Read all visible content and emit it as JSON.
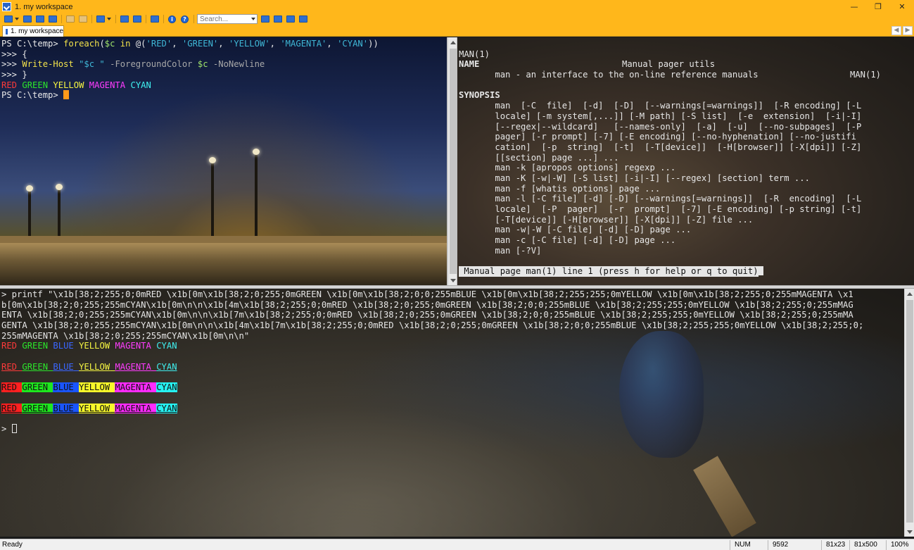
{
  "window": {
    "title": "1. my workspace"
  },
  "toolbar": {
    "search_placeholder": "Search..."
  },
  "tabs": [
    {
      "label": "1. my workspace"
    }
  ],
  "powershell": {
    "lines": [
      {
        "prompt": "PS C:\\temp> ",
        "cmd": "foreach",
        "rest_a": "(",
        "var": "$c",
        "kw": " in ",
        "rest_b": "@(",
        "s1": "'RED'",
        "s2": "'GREEN'",
        "s3": "'YELLOW'",
        "s4": "'MAGENTA'",
        "s5": "'CYAN'",
        "close": "))"
      },
      {
        "text": ">>> {"
      },
      {
        "prompt": ">>> ",
        "cmd": "Write-Host",
        "str": "\"$c \"",
        "param1": "-ForegroundColor",
        "var": "$c",
        "param2": "-NoNewline"
      },
      {
        "text": ">>> }"
      },
      {
        "words": [
          "RED",
          "GREEN",
          "YELLOW",
          "MAGENTA",
          "CYAN"
        ]
      },
      {
        "prompt": "PS C:\\temp> "
      }
    ]
  },
  "man": {
    "header_left": "MAN(1)",
    "header_center": "Manual pager utils",
    "header_right": "MAN(1)",
    "name_heading": "NAME",
    "name_text": "       man - an interface to the on-line reference manuals",
    "synopsis_heading": "SYNOPSIS",
    "synopsis_lines": [
      "       man  [-C  file]  [-d]  [-D]  [--warnings[=warnings]]  [-R encoding] [-L",
      "       locale] [-m system[,...]] [-M path] [-S list]  [-e  extension]  [-i|-I]",
      "       [--regex|--wildcard]   [--names-only]  [-a]  [-u]  [--no-subpages]  [-P",
      "       pager] [-r prompt] [-7] [-E encoding] [--no-hyphenation] [--no-justifi",
      "       cation]  [-p  string]  [-t]  [-T[device]]  [-H[browser]] [-X[dpi]] [-Z]",
      "       [[section] page ...] ...",
      "       man -k [apropos options] regexp ...",
      "       man -K [-w|-W] [-S list] [-i|-I] [--regex] [section] term ...",
      "       man -f [whatis options] page ...",
      "       man -l [-C file] [-d] [-D] [--warnings[=warnings]]  [-R  encoding]  [-L",
      "       locale]  [-P  pager]  [-r  prompt]  [-7] [-E encoding] [-p string] [-t]",
      "       [-T[device]] [-H[browser]] [-X[dpi]] [-Z] file ...",
      "       man -w|-W [-C file] [-d] [-D] page ...",
      "       man -c [-C file] [-d] [-D] page ...",
      "       man [-?V]"
    ],
    "status": " Manual page man(1) line 1 (press h for help or q to quit)"
  },
  "bash": {
    "printf_lines": [
      "> printf \"\\x1b[38;2;255;0;0mRED \\x1b[0m\\x1b[38;2;0;255;0mGREEN \\x1b[0m\\x1b[38;2;0;0;255mBLUE \\x1b[0m\\x1b[38;2;255;255;0mYELLOW \\x1b[0m\\x1b[38;2;255;0;255mMAGENTA \\x1",
      "b[0m\\x1b[38;2;0;255;255mCYAN\\x1b[0m\\n\\n\\x1b[4m\\x1b[38;2;255;0;0mRED \\x1b[38;2;0;255;0mGREEN \\x1b[38;2;0;0;255mBLUE \\x1b[38;2;255;255;0mYELLOW \\x1b[38;2;255;0;255mMAG",
      "ENTA \\x1b[38;2;0;255;255mCYAN\\x1b[0m\\n\\n\\x1b[7m\\x1b[38;2;255;0;0mRED \\x1b[38;2;0;255;0mGREEN \\x1b[38;2;0;0;255mBLUE \\x1b[38;2;255;255;0mYELLOW \\x1b[38;2;255;0;255mMA",
      "GENTA \\x1b[38;2;0;255;255mCYAN\\x1b[0m\\n\\n\\x1b[4m\\x1b[7m\\x1b[38;2;255;0;0mRED \\x1b[38;2;0;255;0mGREEN \\x1b[38;2;0;0;255mBLUE \\x1b[38;2;255;255;0mYELLOW \\x1b[38;2;255;0;",
      "255mMAGENTA \\x1b[38;2;0;255;255mCYAN\\x1b[0m\\n\\n\""
    ],
    "color_words": [
      "RED",
      "GREEN",
      "BLUE",
      "YELLOW",
      "MAGENTA",
      "CYAN"
    ],
    "final_prompt": "> "
  },
  "statusbar": {
    "ready": "Ready",
    "num": "NUM",
    "count": "9592",
    "size1": "81x23",
    "size2": "81x500",
    "zoom": "100%"
  },
  "colors": {
    "titlebar": "#ffb71b",
    "cursor": "#ff9a1a"
  }
}
